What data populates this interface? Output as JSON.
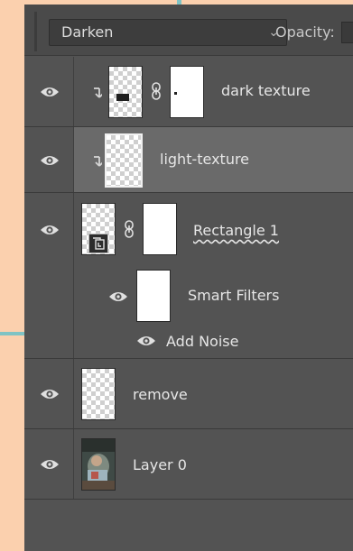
{
  "header": {
    "blend_mode": "Darken",
    "opacity_label": "Opacity:"
  },
  "layers": {
    "dark_texture": {
      "name": "dark texture"
    },
    "light_texture": {
      "name": "light-texture"
    },
    "rectangle_1": {
      "name": "Rectangle 1",
      "smart_filters_label": "Smart Filters",
      "filter_name": "Add Noise"
    },
    "remove": {
      "name": "remove"
    },
    "layer_0": {
      "name": "Layer 0"
    }
  },
  "colors": {
    "panel_bg": "#535353",
    "selected_row": "#6a6a6a",
    "page_bg": "#fbd0ae",
    "accent": "#7fc3c4"
  },
  "icons": [
    "eye-icon",
    "link-icon",
    "clipping-arrow-icon",
    "smart-object-icon",
    "chevron-down-icon"
  ]
}
